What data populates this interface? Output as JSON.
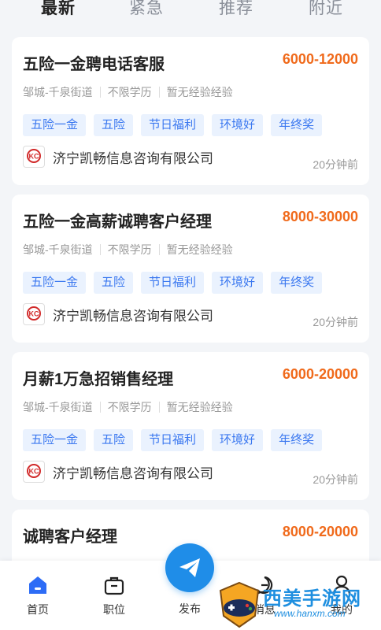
{
  "tabs": [
    {
      "label": "最新",
      "active": true
    },
    {
      "label": "紧急",
      "active": false
    },
    {
      "label": "推荐",
      "active": false
    },
    {
      "label": "附近",
      "active": false
    }
  ],
  "jobs": [
    {
      "title": "五险一金聘电话客服",
      "salary": "6000-12000",
      "location": "邹城-千泉街道",
      "education": "不限学历",
      "experience": "暂无经验经验",
      "tags": [
        "五险一金",
        "五险",
        "节日福利",
        "环境好",
        "年终奖"
      ],
      "company": "济宁凯畅信息咨询有限公司",
      "time": "20分钟前"
    },
    {
      "title": "五险一金高薪诚聘客户经理",
      "salary": "8000-30000",
      "location": "邹城-千泉街道",
      "education": "不限学历",
      "experience": "暂无经验经验",
      "tags": [
        "五险一金",
        "五险",
        "节日福利",
        "环境好",
        "年终奖"
      ],
      "company": "济宁凯畅信息咨询有限公司",
      "time": "20分钟前"
    },
    {
      "title": "月薪1万急招销售经理",
      "salary": "6000-20000",
      "location": "邹城-千泉街道",
      "education": "不限学历",
      "experience": "暂无经验经验",
      "tags": [
        "五险一金",
        "五险",
        "节日福利",
        "环境好",
        "年终奖"
      ],
      "company": "济宁凯畅信息咨询有限公司",
      "time": "20分钟前"
    },
    {
      "title": "诚聘客户经理",
      "salary": "8000-20000"
    }
  ],
  "tabbar": {
    "home": "首页",
    "jobs": "职位",
    "publish": "发布",
    "messages": "消息",
    "profile": "我的"
  },
  "watermark": {
    "text": "西美手游网",
    "url": "www.hanxm.com"
  },
  "colors": {
    "accent": "#2d6cf6",
    "salary": "#f06a1b",
    "tag_bg": "#eaf2fe",
    "tag_text": "#3b78f0",
    "publish": "#1f8de8"
  }
}
